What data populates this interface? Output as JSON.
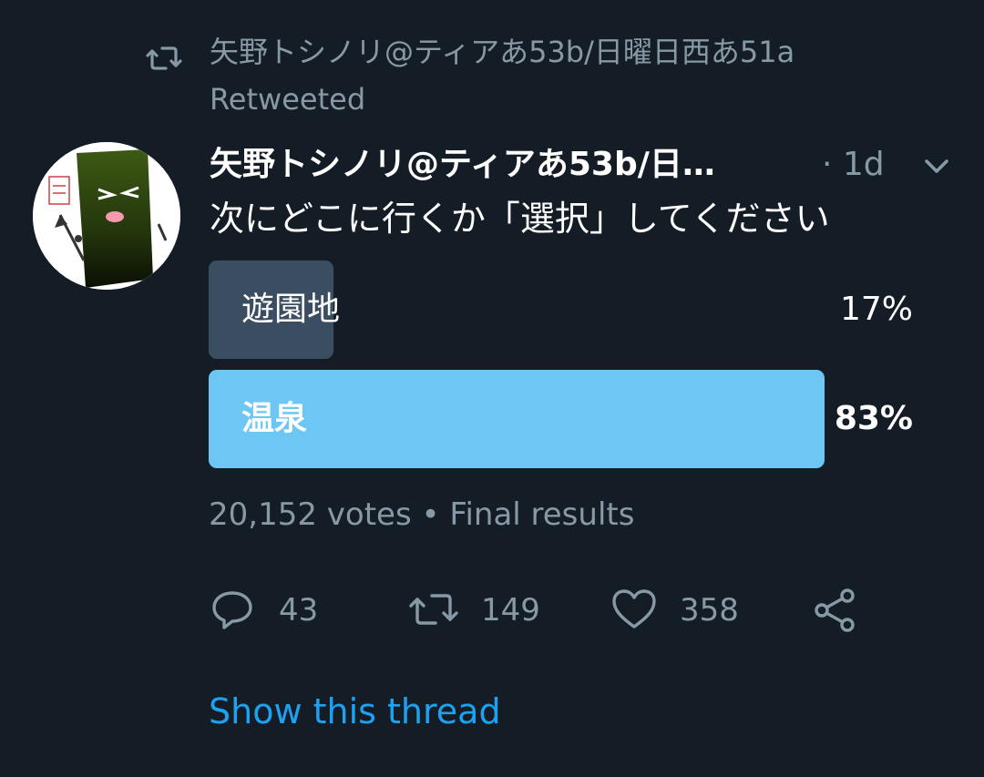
{
  "retweet_context": {
    "retweeter": "矢野トシノリ@ティアあ53b/日曜日西あ51a",
    "label": "Retweeted"
  },
  "tweet": {
    "author": "矢野トシノリ@ティアあ53b/日…",
    "time": "· 1d",
    "text": "次にどこに行くか「選択」してください"
  },
  "poll": {
    "options": [
      {
        "label": "遊園地",
        "percent": "17%",
        "fraction": 0.17
      },
      {
        "label": "温泉",
        "percent": "83%",
        "fraction": 0.83
      }
    ],
    "votes": "20,152 votes",
    "separator": "•",
    "status": "Final results"
  },
  "actions": {
    "replies": "43",
    "retweets": "149",
    "likes": "358"
  },
  "thread_link": "Show this thread",
  "colors": {
    "background": "#141d26",
    "muted": "#8899a6",
    "accent": "#1da1f2",
    "winning_bar": "#6ec6f5",
    "losing_bar": "#3b4d60"
  },
  "icons": [
    "retweet-icon",
    "chevron-down-icon",
    "reply-icon",
    "retweet-icon",
    "heart-icon",
    "share-icon"
  ]
}
